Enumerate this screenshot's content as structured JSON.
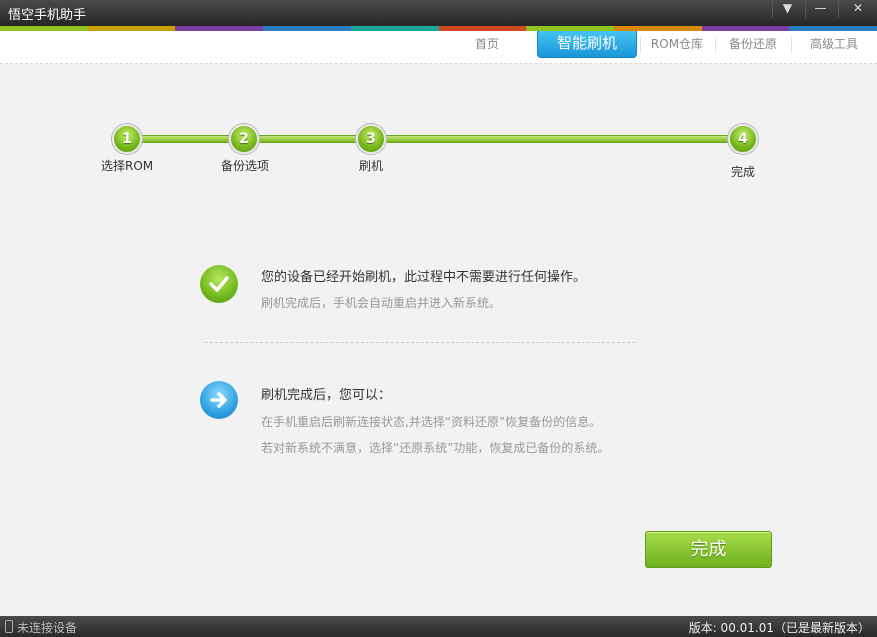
{
  "window": {
    "title": "悟空手机助手",
    "menu_glyph": "▼",
    "min_glyph": "—",
    "close_glyph": "✕"
  },
  "colors": {
    "accent_blue": "#1a96d8",
    "success_green": "#74b51c",
    "colorbar": [
      "#8dc21f",
      "#c8a000",
      "#7b3fa0",
      "#2b7cc0",
      "#1aa79a",
      "#d04a20",
      "#8dc21f",
      "#d88a10",
      "#7b3fa0",
      "#2b7cc0"
    ]
  },
  "nav": {
    "items": [
      {
        "label": "首页"
      },
      {
        "label": "智能刷机"
      },
      {
        "label": "ROM仓库"
      },
      {
        "label": "备份还原"
      },
      {
        "label": "高级工具"
      }
    ],
    "active": "智能刷机"
  },
  "steps": [
    {
      "number": "1",
      "label": "选择ROM"
    },
    {
      "number": "2",
      "label": "备份选项"
    },
    {
      "number": "3",
      "label": "刷机"
    },
    {
      "number": "4",
      "label": "完成"
    }
  ],
  "messages": {
    "started": {
      "icon": "check-icon",
      "title": "您的设备已经开始刷机，此过程中不需要进行任何操作。",
      "subtitle": "刷机完成后，手机会自动重启并进入新系统。"
    },
    "after": {
      "icon": "arrow-right-icon",
      "title": "刷机完成后，您可以：",
      "line1": "在手机重启后刷新连接状态,并选择“资料还原”恢复备份的信息。",
      "line2": "若对新系统不满意，选择“还原系统”功能，恢复成已备份的系统。"
    }
  },
  "done_button": "完成",
  "status": {
    "device": "未连接设备",
    "version": "版本: 00.01.01（已是最新版本）"
  }
}
